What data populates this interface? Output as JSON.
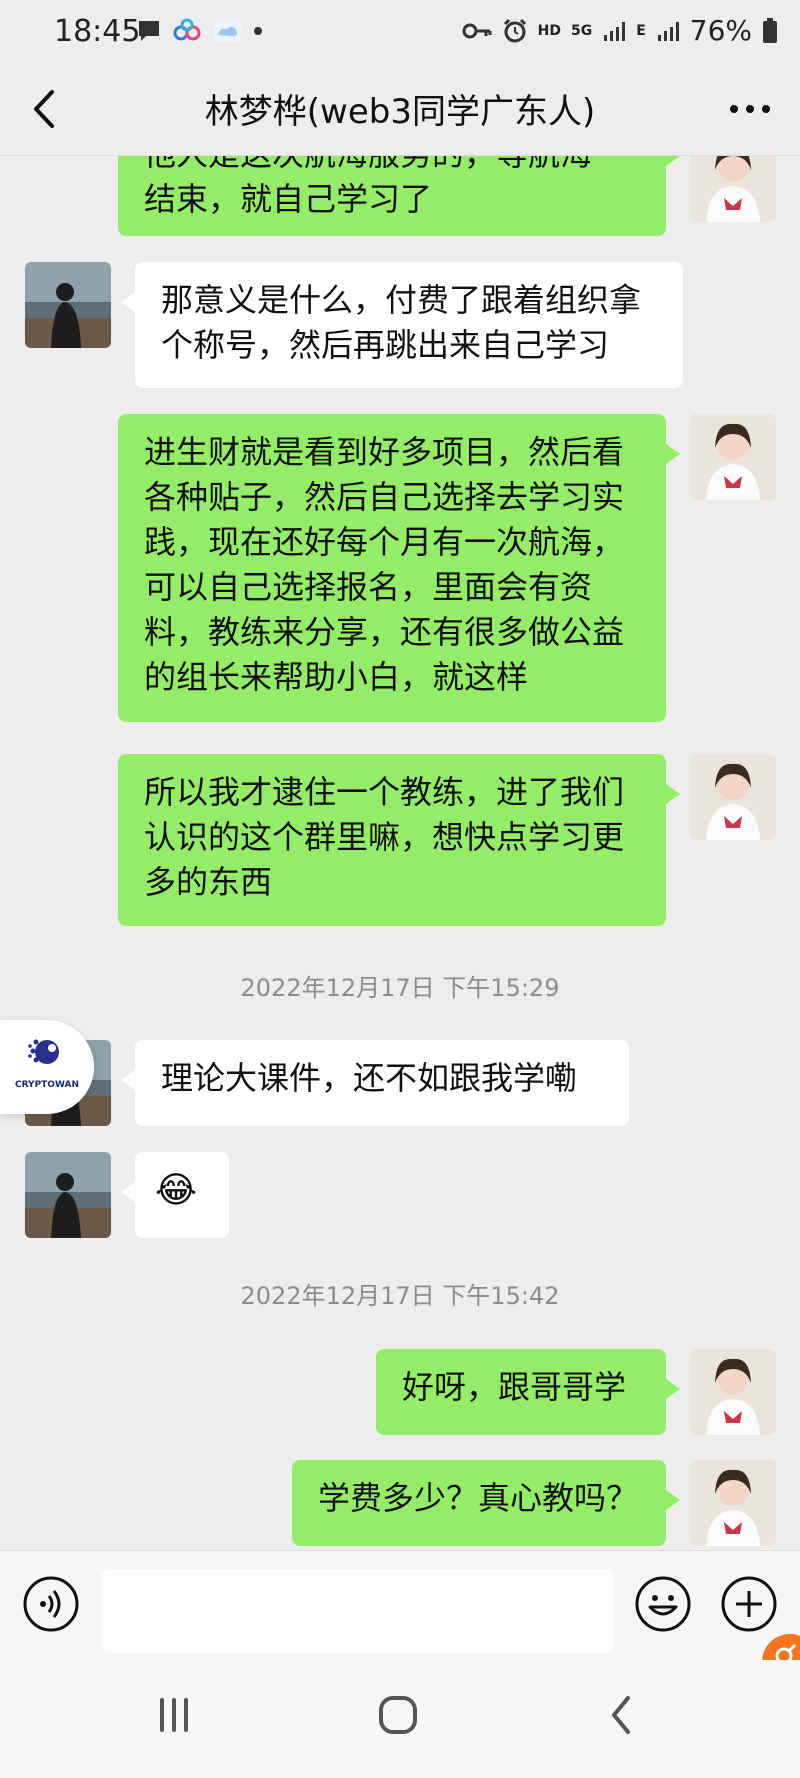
{
  "status_bar": {
    "time": "18:45",
    "network_hd": "HD",
    "network_5g": "5G",
    "network_e": "E",
    "battery": "76%"
  },
  "header": {
    "title": "林梦桦(web3同学广东人)"
  },
  "messages": [
    {
      "side": "out",
      "text_lines": [
        "他人是这次航海服务的，等航海",
        "结束，就自己学习了"
      ]
    },
    {
      "side": "in",
      "text_lines": [
        "那意义是什么，付费了跟着组织拿",
        "个称号，然后再跳出来自己学习"
      ]
    },
    {
      "side": "out",
      "text_lines": [
        "进生财就是看到好多项目，然后看",
        "各种贴子，然后自己选择去学习实",
        "践，现在还好每个月有一次航海，",
        "可以自己选择报名，里面会有资",
        "料，教练来分享，还有很多做公益",
        "的组长来帮助小白，就这样"
      ]
    },
    {
      "side": "out",
      "text_lines": [
        "所以我才逮住一个教练，进了我们",
        "认识的这个群里嘛，想快点学习更",
        "多的东西"
      ]
    },
    {
      "side": "in",
      "text_lines": [
        "理论大课件，还不如跟我学嘞"
      ]
    },
    {
      "side": "in",
      "text_lines": [
        "😂"
      ]
    },
    {
      "side": "out",
      "text_lines": [
        "好呀，跟哥哥学"
      ]
    },
    {
      "side": "out",
      "text_lines": [
        "学费多少？真心教吗？"
      ]
    }
  ],
  "timestamps": [
    "2022年12月17日 下午15:29",
    "2022年12月17日 下午15:42"
  ],
  "floating_logo": {
    "text": "CRYPTOWAN"
  },
  "input_bar": {
    "placeholder": "",
    "icons": [
      "voice-icon",
      "emoji-icon",
      "plus-icon"
    ]
  },
  "colors": {
    "outgoing_bubble": "#95ec69",
    "incoming_bubble": "#ffffff",
    "chat_background": "#ededed",
    "badge_orange": "#f4741f"
  }
}
